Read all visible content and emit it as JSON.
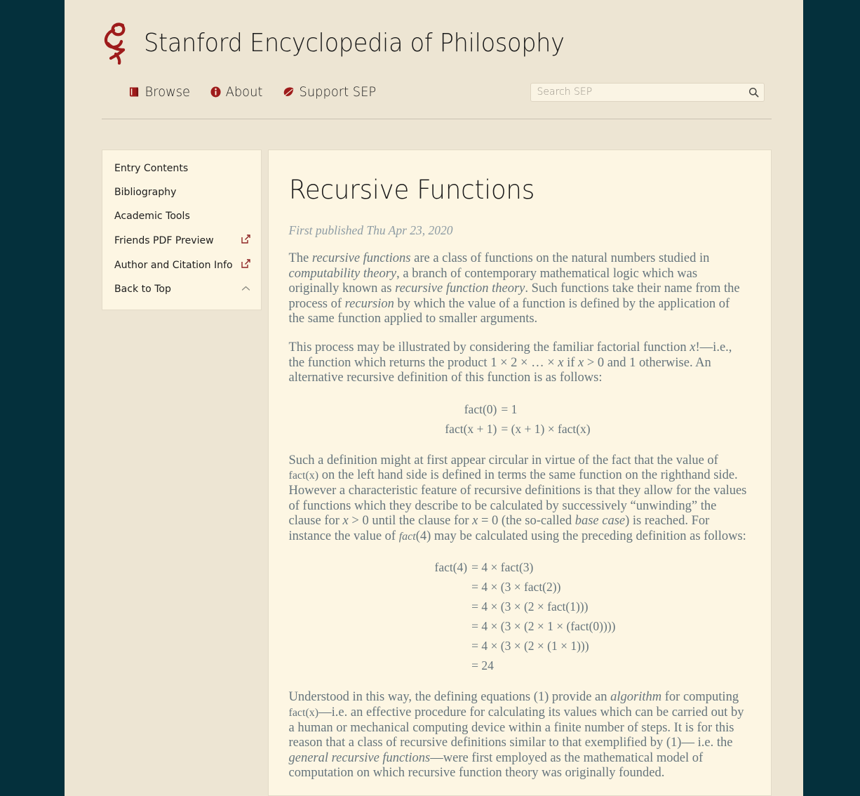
{
  "colors": {
    "outer_background": "#04303c",
    "page_background": "#ede5d3",
    "panel_background": "#fdf6e3",
    "brand_red": "#9e1b1b",
    "body_text": "#65747c",
    "heading_text": "#1b1b1b",
    "muted_text": "#8e9ca4"
  },
  "header": {
    "logo_icon": "sep-thinker-logo-icon",
    "site_title": "Stanford Encyclopedia of Philosophy",
    "nav": [
      {
        "label": "Browse",
        "icon": "book-icon"
      },
      {
        "label": "About",
        "icon": "info-circle-icon"
      },
      {
        "label": "Support SEP",
        "icon": "leaf-icon"
      }
    ],
    "search": {
      "placeholder": "Search SEP",
      "value": "",
      "button_icon": "search-icon"
    }
  },
  "sidebar": {
    "items": [
      {
        "label": "Entry Contents",
        "icon": ""
      },
      {
        "label": "Bibliography",
        "icon": ""
      },
      {
        "label": "Academic Tools",
        "icon": ""
      },
      {
        "label": "Friends PDF Preview",
        "icon": "external-link-icon"
      },
      {
        "label": "Author and Citation Info",
        "icon": "external-link-icon"
      },
      {
        "label": "Back to Top",
        "icon": "chevron-up-icon"
      }
    ]
  },
  "entry": {
    "title": "Recursive Functions",
    "published": "First published Thu Apr 23, 2020",
    "paragraph_1": {
      "p1": "The ",
      "i1": "recursive functions",
      "p2": " are a class of functions on the natural numbers studied in ",
      "i2": "computability theory",
      "p3": ", a branch of contemporary mathematical logic which was originally known as ",
      "i3": "recursive function theory",
      "p4": ". Such functions take their name from the process of ",
      "i4": "recursion",
      "p5": " by which the value of a function is defined by the application of the same function applied to smaller arguments."
    },
    "paragraph_2": {
      "p1": "This process may be illustrated by considering the familiar factorial function ",
      "v1": "x",
      "p2": "!—i.e., the function which returns the product 1 × 2 × … × ",
      "v2": "x",
      "p3": " if ",
      "v3": "x",
      "p4": " > 0 and 1 otherwise. An alternative recursive definition of this function is as follows:"
    },
    "equation_1": {
      "rows": [
        {
          "lhs": "fact(0)",
          "rhs": "= 1"
        },
        {
          "lhs": "fact(x + 1)",
          "rhs": "= (x + 1) × fact(x)"
        }
      ]
    },
    "paragraph_3": {
      "p1": "Such a definition might at first appear circular in virtue of the fact that the value of ",
      "f1": "fact(x)",
      "p2": " on the left hand side is defined in terms the same function on the righthand side. However a characteristic feature of recursive definitions is that they allow for the values of functions which they describe to be calculated by successively “unwinding” the clause for ",
      "v1": "x",
      "p3": " > 0 until the clause for ",
      "v2": "x",
      "p4": " = 0 (the so-called ",
      "i1": "base case",
      "p5": ") is reached. For instance the value of ",
      "f2": "fact",
      "p6": "(4) may be calculated using the preceding definition as follows:"
    },
    "equation_2": {
      "rows": [
        {
          "lhs": "fact(4)",
          "rhs": "= 4 × fact(3)"
        },
        {
          "lhs": "",
          "rhs": "= 4 × (3 × fact(2))"
        },
        {
          "lhs": "",
          "rhs": "= 4 × (3 × (2 × fact(1)))"
        },
        {
          "lhs": "",
          "rhs": "= 4 × (3 × (2 × 1 × (fact(0))))"
        },
        {
          "lhs": "",
          "rhs": "= 4 × (3 × (2 × (1 × 1)))"
        },
        {
          "lhs": "",
          "rhs": "= 24"
        }
      ]
    },
    "paragraph_4": {
      "p1": "Understood in this way, the defining equations (1) provide an ",
      "i1": "algorithm",
      "p2": " for computing ",
      "f1": "fact(x)",
      "p3": "—i.e. an effective procedure for calculating its values which can be carried out by a human or mechanical computing device within a finite number of steps. It is for this reason that a class of recursive definitions similar to that exemplified by (1)— i.e. the ",
      "i2": "general recursive functions",
      "p4": "—were first employed as the mathematical model of computation on which recursive function theory was originally founded."
    }
  }
}
